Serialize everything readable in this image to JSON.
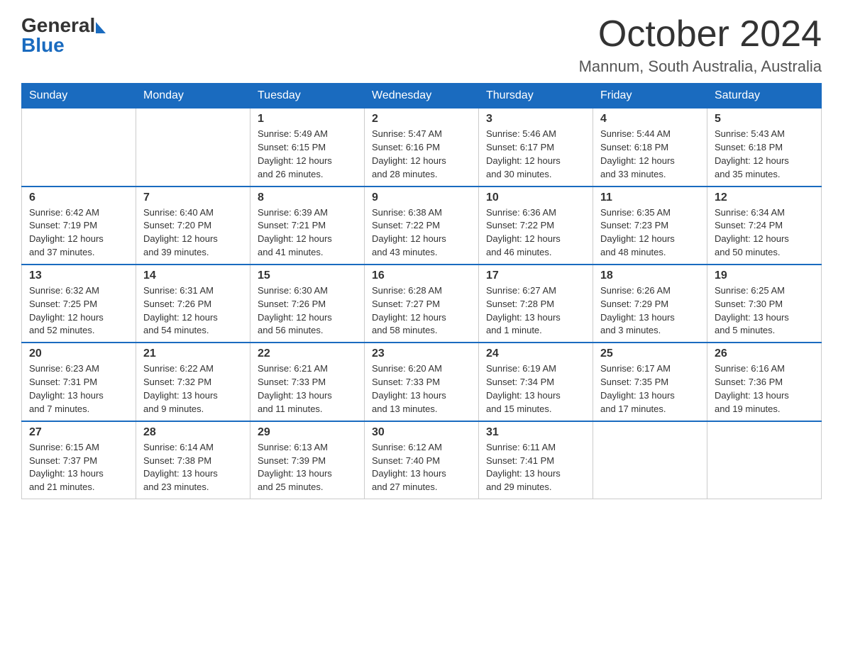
{
  "header": {
    "logo_general": "General",
    "logo_blue": "Blue",
    "month_title": "October 2024",
    "location": "Mannum, South Australia, Australia"
  },
  "calendar": {
    "days_of_week": [
      "Sunday",
      "Monday",
      "Tuesday",
      "Wednesday",
      "Thursday",
      "Friday",
      "Saturday"
    ],
    "weeks": [
      [
        {
          "day": "",
          "info": ""
        },
        {
          "day": "",
          "info": ""
        },
        {
          "day": "1",
          "info": "Sunrise: 5:49 AM\nSunset: 6:15 PM\nDaylight: 12 hours\nand 26 minutes."
        },
        {
          "day": "2",
          "info": "Sunrise: 5:47 AM\nSunset: 6:16 PM\nDaylight: 12 hours\nand 28 minutes."
        },
        {
          "day": "3",
          "info": "Sunrise: 5:46 AM\nSunset: 6:17 PM\nDaylight: 12 hours\nand 30 minutes."
        },
        {
          "day": "4",
          "info": "Sunrise: 5:44 AM\nSunset: 6:18 PM\nDaylight: 12 hours\nand 33 minutes."
        },
        {
          "day": "5",
          "info": "Sunrise: 5:43 AM\nSunset: 6:18 PM\nDaylight: 12 hours\nand 35 minutes."
        }
      ],
      [
        {
          "day": "6",
          "info": "Sunrise: 6:42 AM\nSunset: 7:19 PM\nDaylight: 12 hours\nand 37 minutes."
        },
        {
          "day": "7",
          "info": "Sunrise: 6:40 AM\nSunset: 7:20 PM\nDaylight: 12 hours\nand 39 minutes."
        },
        {
          "day": "8",
          "info": "Sunrise: 6:39 AM\nSunset: 7:21 PM\nDaylight: 12 hours\nand 41 minutes."
        },
        {
          "day": "9",
          "info": "Sunrise: 6:38 AM\nSunset: 7:22 PM\nDaylight: 12 hours\nand 43 minutes."
        },
        {
          "day": "10",
          "info": "Sunrise: 6:36 AM\nSunset: 7:22 PM\nDaylight: 12 hours\nand 46 minutes."
        },
        {
          "day": "11",
          "info": "Sunrise: 6:35 AM\nSunset: 7:23 PM\nDaylight: 12 hours\nand 48 minutes."
        },
        {
          "day": "12",
          "info": "Sunrise: 6:34 AM\nSunset: 7:24 PM\nDaylight: 12 hours\nand 50 minutes."
        }
      ],
      [
        {
          "day": "13",
          "info": "Sunrise: 6:32 AM\nSunset: 7:25 PM\nDaylight: 12 hours\nand 52 minutes."
        },
        {
          "day": "14",
          "info": "Sunrise: 6:31 AM\nSunset: 7:26 PM\nDaylight: 12 hours\nand 54 minutes."
        },
        {
          "day": "15",
          "info": "Sunrise: 6:30 AM\nSunset: 7:26 PM\nDaylight: 12 hours\nand 56 minutes."
        },
        {
          "day": "16",
          "info": "Sunrise: 6:28 AM\nSunset: 7:27 PM\nDaylight: 12 hours\nand 58 minutes."
        },
        {
          "day": "17",
          "info": "Sunrise: 6:27 AM\nSunset: 7:28 PM\nDaylight: 13 hours\nand 1 minute."
        },
        {
          "day": "18",
          "info": "Sunrise: 6:26 AM\nSunset: 7:29 PM\nDaylight: 13 hours\nand 3 minutes."
        },
        {
          "day": "19",
          "info": "Sunrise: 6:25 AM\nSunset: 7:30 PM\nDaylight: 13 hours\nand 5 minutes."
        }
      ],
      [
        {
          "day": "20",
          "info": "Sunrise: 6:23 AM\nSunset: 7:31 PM\nDaylight: 13 hours\nand 7 minutes."
        },
        {
          "day": "21",
          "info": "Sunrise: 6:22 AM\nSunset: 7:32 PM\nDaylight: 13 hours\nand 9 minutes."
        },
        {
          "day": "22",
          "info": "Sunrise: 6:21 AM\nSunset: 7:33 PM\nDaylight: 13 hours\nand 11 minutes."
        },
        {
          "day": "23",
          "info": "Sunrise: 6:20 AM\nSunset: 7:33 PM\nDaylight: 13 hours\nand 13 minutes."
        },
        {
          "day": "24",
          "info": "Sunrise: 6:19 AM\nSunset: 7:34 PM\nDaylight: 13 hours\nand 15 minutes."
        },
        {
          "day": "25",
          "info": "Sunrise: 6:17 AM\nSunset: 7:35 PM\nDaylight: 13 hours\nand 17 minutes."
        },
        {
          "day": "26",
          "info": "Sunrise: 6:16 AM\nSunset: 7:36 PM\nDaylight: 13 hours\nand 19 minutes."
        }
      ],
      [
        {
          "day": "27",
          "info": "Sunrise: 6:15 AM\nSunset: 7:37 PM\nDaylight: 13 hours\nand 21 minutes."
        },
        {
          "day": "28",
          "info": "Sunrise: 6:14 AM\nSunset: 7:38 PM\nDaylight: 13 hours\nand 23 minutes."
        },
        {
          "day": "29",
          "info": "Sunrise: 6:13 AM\nSunset: 7:39 PM\nDaylight: 13 hours\nand 25 minutes."
        },
        {
          "day": "30",
          "info": "Sunrise: 6:12 AM\nSunset: 7:40 PM\nDaylight: 13 hours\nand 27 minutes."
        },
        {
          "day": "31",
          "info": "Sunrise: 6:11 AM\nSunset: 7:41 PM\nDaylight: 13 hours\nand 29 minutes."
        },
        {
          "day": "",
          "info": ""
        },
        {
          "day": "",
          "info": ""
        }
      ]
    ]
  }
}
